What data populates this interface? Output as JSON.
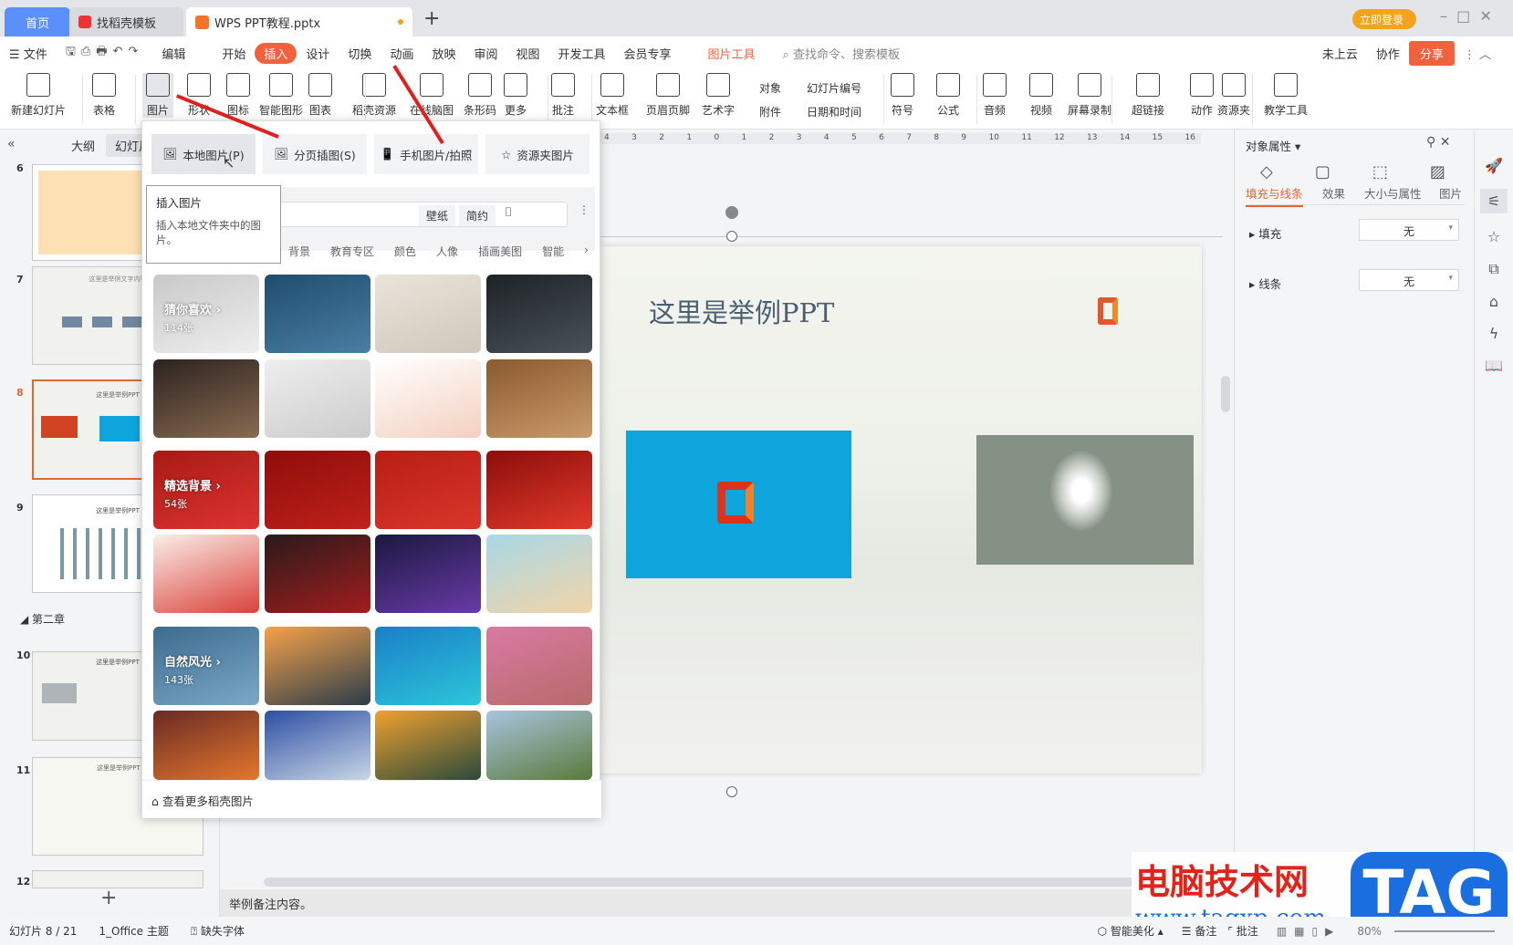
{
  "tabs": {
    "home": "首页",
    "docer": "找稻壳模板",
    "doc": "WPS PPT教程.pptx",
    "login": "立即登录"
  },
  "menu": {
    "file": "文件",
    "edit": "编辑",
    "items": [
      "开始",
      "插入",
      "设计",
      "切换",
      "动画",
      "放映",
      "审阅",
      "视图",
      "开发工具",
      "会员专享"
    ],
    "picture_tools": "图片工具",
    "search": "查找命令、搜索模板",
    "cloud": "未上云",
    "collab": "协作",
    "share": "分享"
  },
  "ribbon": {
    "items": [
      "新建幻灯片",
      "表格",
      "图片",
      "形状",
      "图标",
      "智能图形",
      "图表",
      "稻壳资源",
      "在线脑图",
      "条形码",
      "更多",
      "批注",
      "文本框",
      "页眉页脚",
      "艺术字",
      "符号",
      "公式",
      "音频",
      "视频",
      "屏幕录制",
      "超链接",
      "动作",
      "资源夹",
      "教学工具"
    ],
    "small": [
      "对象",
      "幻灯片编号",
      "附件",
      "日期和时间"
    ]
  },
  "left_panel": {
    "tab_outline": "大纲",
    "tab_slides": "幻灯片",
    "slides": [
      "6",
      "7",
      "8",
      "9",
      "10",
      "11",
      "12"
    ],
    "section": "第二章",
    "thumb_titles": [
      "这里是举例文字内容",
      "这里是举例PPT",
      "这里是举例PPT",
      "这里是举例PPT",
      "这里是举例PPT"
    ]
  },
  "dropdown": {
    "sources": [
      "本地图片(P)",
      "分页插图(S)",
      "手机图片/拍照",
      "资源夹图片"
    ],
    "tooltip_title": "插入图片",
    "tooltip_body": "插入本地文件夹中的图片。",
    "search_tags": [
      "壁纸",
      "简约"
    ],
    "search_partial": "色",
    "categories": [
      "背景",
      "教育专区",
      "颜色",
      "人像",
      "插画美图",
      "智能"
    ],
    "groups": [
      {
        "label": "猜你喜欢",
        "count": "114张"
      },
      {
        "label": "精选背景",
        "count": "54张"
      },
      {
        "label": "自然风光",
        "count": "143张"
      }
    ],
    "more": "查看更多稻壳图片"
  },
  "ruler": [
    "4",
    "3",
    "2",
    "1",
    "0",
    "1",
    "2",
    "3",
    "4",
    "5",
    "6",
    "7",
    "8",
    "9",
    "10",
    "11",
    "12",
    "13",
    "14",
    "15",
    "16"
  ],
  "slide": {
    "title": "这里是举例PPT"
  },
  "right_panel": {
    "title": "对象属性",
    "tabs": [
      "填充与线条",
      "效果",
      "大小与属性",
      "图片"
    ],
    "fill_label": "填充",
    "fill_value": "无",
    "line_label": "线条",
    "line_value": "无"
  },
  "notes": "举例备注内容。",
  "status": {
    "slide": "幻灯片 8 / 21",
    "theme": "1_Office 主题",
    "font": "缺失字体",
    "beautify": "智能美化",
    "notes": "备注",
    "comment": "批注",
    "zoom": "80%"
  },
  "watermark": {
    "site_cn": "电脑技术网",
    "url": "www.tagxp.com",
    "tag": "TAG"
  },
  "colors": {
    "accent": "#e8623a",
    "home_tab": "#5b8ff9",
    "insert": "#f0623e"
  }
}
